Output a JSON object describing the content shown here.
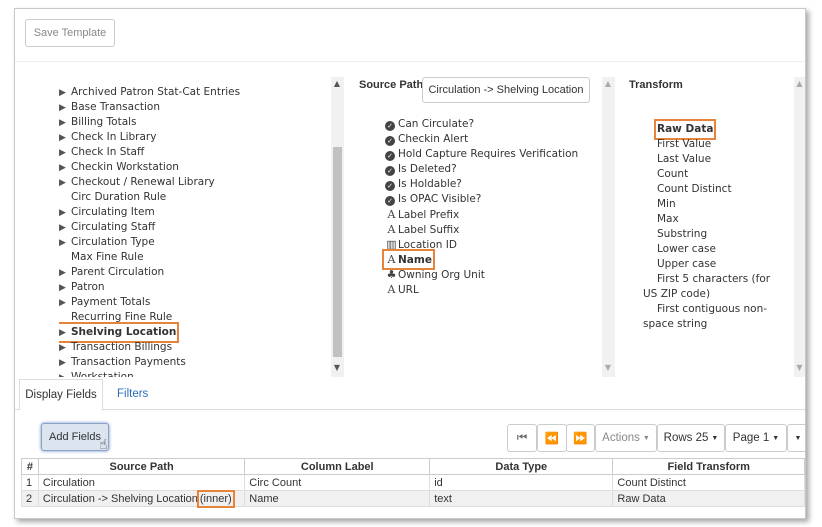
{
  "toolbar": {
    "save_template": "Save Template"
  },
  "source_tree": {
    "items": [
      {
        "label": "Archived Patron Stat-Cat Entries",
        "expandable": true,
        "bold": false
      },
      {
        "label": "Base Transaction",
        "expandable": true,
        "bold": false
      },
      {
        "label": "Billing Totals",
        "expandable": true,
        "bold": false
      },
      {
        "label": "Check In Library",
        "expandable": true,
        "bold": false
      },
      {
        "label": "Check In Staff",
        "expandable": true,
        "bold": false
      },
      {
        "label": "Checkin Workstation",
        "expandable": true,
        "bold": false
      },
      {
        "label": "Checkout / Renewal Library",
        "expandable": true,
        "bold": false
      },
      {
        "label": "Circ Duration Rule",
        "expandable": false,
        "bold": false
      },
      {
        "label": "Circulating Item",
        "expandable": true,
        "bold": false
      },
      {
        "label": "Circulating Staff",
        "expandable": true,
        "bold": false
      },
      {
        "label": "Circulation Type",
        "expandable": true,
        "bold": false
      },
      {
        "label": "Max Fine Rule",
        "expandable": false,
        "bold": false
      },
      {
        "label": "Parent Circulation",
        "expandable": true,
        "bold": false
      },
      {
        "label": "Patron",
        "expandable": true,
        "bold": false
      },
      {
        "label": "Payment Totals",
        "expandable": true,
        "bold": false
      },
      {
        "label": "Recurring Fine Rule",
        "expandable": false,
        "bold": false
      },
      {
        "label": "Shelving Location",
        "expandable": true,
        "bold": true,
        "highlight": true
      },
      {
        "label": "Transaction Billings",
        "expandable": true,
        "bold": false
      },
      {
        "label": "Transaction Payments",
        "expandable": true,
        "bold": false
      },
      {
        "label": "Workstation",
        "expandable": true,
        "bold": false
      }
    ]
  },
  "source_path": {
    "label": "Source Path",
    "value": "Circulation -> Shelving Location",
    "fields": [
      {
        "label": "Can Circulate?",
        "icon": "check-circle-icon"
      },
      {
        "label": "Checkin Alert",
        "icon": "check-circle-icon"
      },
      {
        "label": "Hold Capture Requires Verification",
        "icon": "check-circle-icon"
      },
      {
        "label": "Is Deleted?",
        "icon": "check-circle-icon"
      },
      {
        "label": "Is Holdable?",
        "icon": "check-circle-icon"
      },
      {
        "label": "Is OPAC Visible?",
        "icon": "check-circle-icon"
      },
      {
        "label": "Label Prefix",
        "icon": "text-icon"
      },
      {
        "label": "Label Suffix",
        "icon": "text-icon"
      },
      {
        "label": "Location ID",
        "icon": "barcode-icon"
      },
      {
        "label": "Name",
        "icon": "text-icon",
        "bold": true,
        "highlight": true
      },
      {
        "label": "Owning Org Unit",
        "icon": "org-tree-icon"
      },
      {
        "label": "URL",
        "icon": "text-icon"
      }
    ]
  },
  "transform": {
    "label": "Transform",
    "items": [
      {
        "label": "Raw Data",
        "bold": true,
        "highlight": true
      },
      {
        "label": "First Value"
      },
      {
        "label": "Last Value"
      },
      {
        "label": "Count"
      },
      {
        "label": "Count Distinct"
      },
      {
        "label": "Min"
      },
      {
        "label": "Max"
      },
      {
        "label": "Substring"
      },
      {
        "label": "Lower case"
      },
      {
        "label": "Upper case"
      },
      {
        "label": "First 5 characters (for",
        "cont": "US ZIP code)"
      },
      {
        "label": "First contiguous non-",
        "cont": "space string"
      }
    ]
  },
  "tabs": {
    "display_fields": "Display Fields",
    "filters": "Filters"
  },
  "actions": {
    "add_fields": "Add Fields",
    "actions_label": "Actions",
    "rows_label": "Rows 25",
    "page_label": "Page 1"
  },
  "grid": {
    "headers": [
      "#",
      "Source Path",
      "Column Label",
      "Data Type",
      "Field Transform"
    ],
    "rows": [
      {
        "num": "1",
        "path": "Circulation",
        "inner": "",
        "label": "Circ Count",
        "type": "id",
        "transform": "Count Distinct"
      },
      {
        "num": "2",
        "path": "Circulation -> Shelving Location",
        "inner": "(inner)",
        "label": "Name",
        "type": "text",
        "transform": "Raw Data"
      }
    ]
  },
  "colors": {
    "highlight": "#e8833a",
    "link": "#2a6ebb",
    "header_bg": "#f5f5f5"
  }
}
